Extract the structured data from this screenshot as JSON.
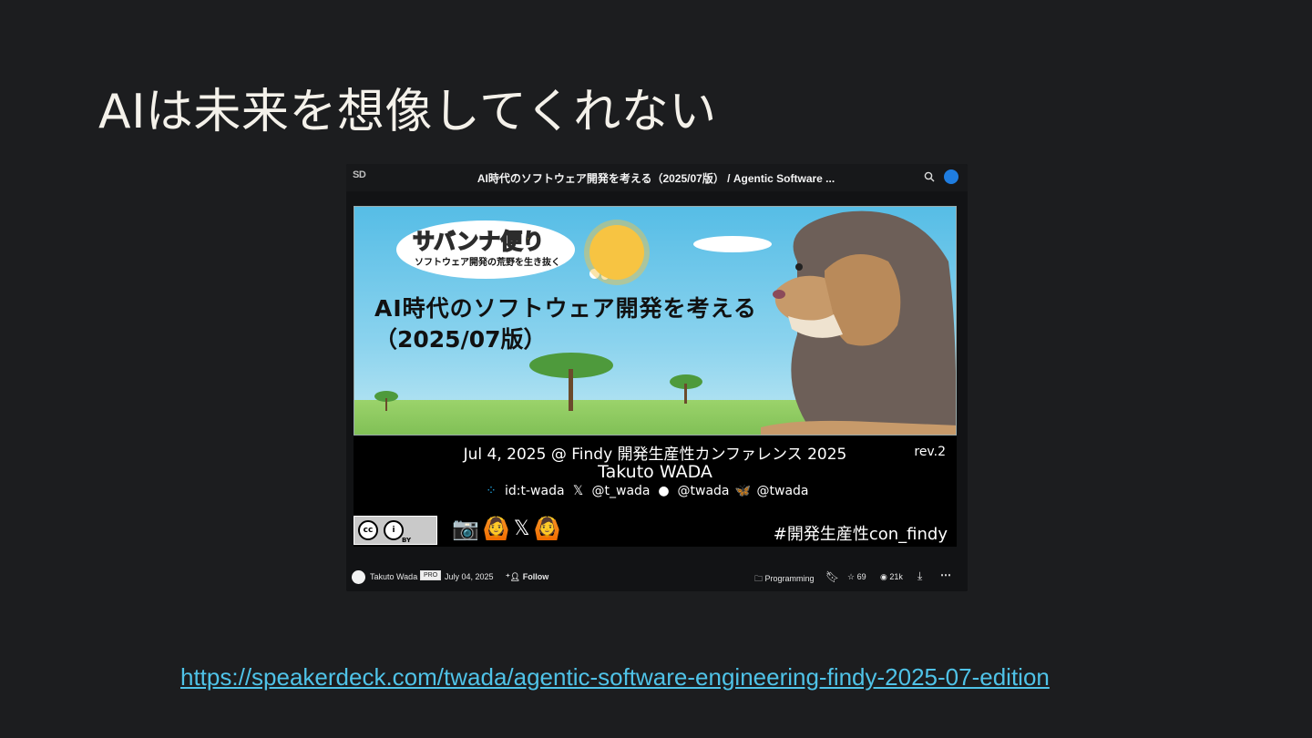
{
  "slide": {
    "title": "AIは未来を想像してくれない",
    "url": "https://speakerdeck.com/twada/agentic-software-engineering-findy-2025-07-edition"
  },
  "embed": {
    "logo": "SD",
    "title": "AI時代のソフトウェア開発を考える（2025/07版） / Agentic Software ...",
    "icons": {
      "search": "search-icon",
      "avatar": "user-avatar-icon"
    },
    "cover": {
      "badge_main": "サバンナ便り",
      "badge_sub": "ソフトウェア開発の荒野を生き抜く",
      "headline": "AI時代のソフトウェア開発を考える",
      "subhead": "（2025/07版）",
      "event": "Jul 4, 2025 @ Findy 開発生産性カンファレンス 2025",
      "rev": "rev.2",
      "speaker": "Takuto WADA",
      "socials": [
        {
          "icon": "hatena-icon",
          "handle": "id:t-wada"
        },
        {
          "icon": "x-icon",
          "handle": "@t_wada"
        },
        {
          "icon": "github-icon",
          "handle": "@twada"
        },
        {
          "icon": "bluesky-icon",
          "handle": "@twada"
        }
      ],
      "license_by": "BY",
      "hashtag": "#開発生産性con_findy"
    },
    "footer": {
      "author": "Takuto Wada",
      "pro": "PRO",
      "date": "July 04, 2025",
      "follow": "Follow",
      "category": "Programming",
      "stars": "69",
      "views": "21k"
    }
  },
  "colors": {
    "background": "#1c1d1f",
    "link": "#4fc3e8",
    "sky": "#56bde6"
  }
}
